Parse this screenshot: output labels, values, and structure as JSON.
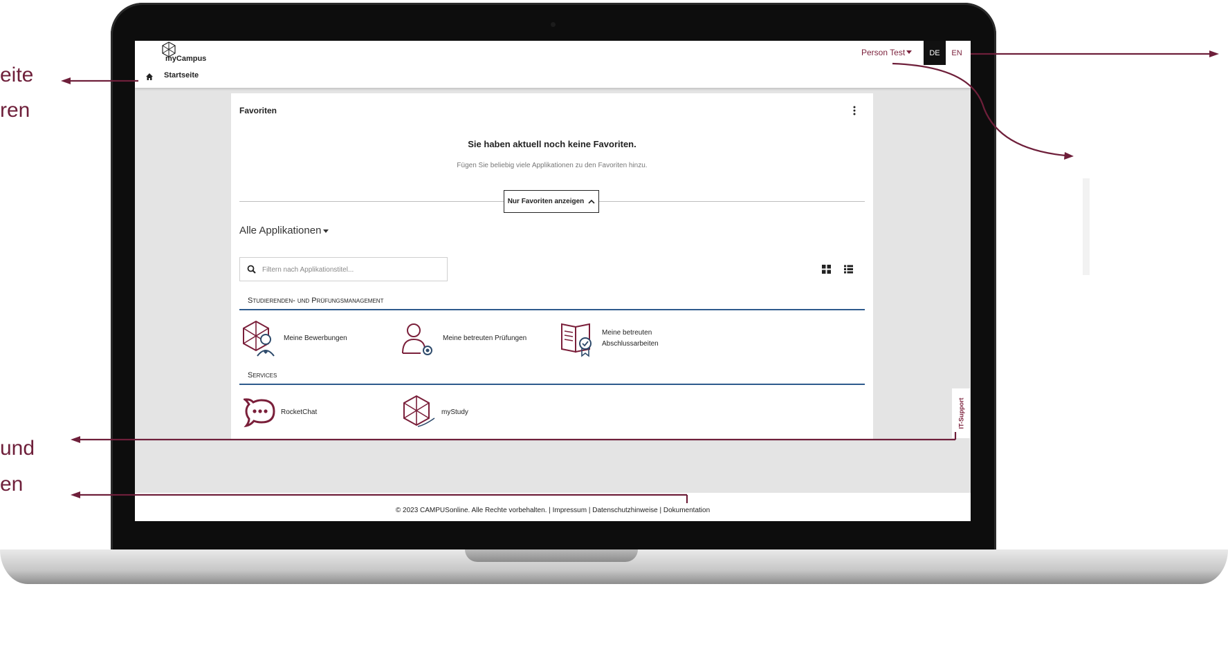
{
  "annotations": {
    "left_1_line1": "eite",
    "left_1_line2": "ren",
    "left_2_line1": "und",
    "left_2_line2": "en"
  },
  "header": {
    "logo_text": "myCampus",
    "breadcrumb": "Startseite",
    "user_name": "Person Test",
    "lang_de": "DE",
    "lang_en": "EN"
  },
  "favorites": {
    "title": "Favoriten",
    "empty_heading": "Sie haben aktuell noch keine Favoriten.",
    "empty_text": "Fügen Sie beliebig viele Applikationen zu den Favoriten hinzu.",
    "toggle_label": "Nur Favoriten anzeigen"
  },
  "apps": {
    "title": "Alle Applikationen",
    "filter_placeholder": "Filtern nach Applikationstitel...",
    "sections": [
      {
        "title": "Studierenden- und Prüfungsmanagement",
        "items": [
          {
            "label": "Meine Bewerbungen",
            "icon": "applications-icon"
          },
          {
            "label": "Meine betreuten Prüfungen",
            "icon": "supervised-exams-icon"
          },
          {
            "label": "Meine betreuten Abschlussarbeiten",
            "icon": "supervised-theses-icon"
          }
        ]
      },
      {
        "title": "Services",
        "items": [
          {
            "label": "RocketChat",
            "icon": "chat-icon"
          },
          {
            "label": "myStudy",
            "icon": "mystudy-icon"
          }
        ]
      }
    ]
  },
  "it_support": "IT-Support",
  "footer": "© 2023 CAMPUSonline. Alle Rechte vorbehalten. | Impressum | Datenschutzhinweise | Dokumentation",
  "colors": {
    "brand": "#7a1f3a",
    "section_rule": "#2d5a8c",
    "background": "#e4e4e4"
  }
}
